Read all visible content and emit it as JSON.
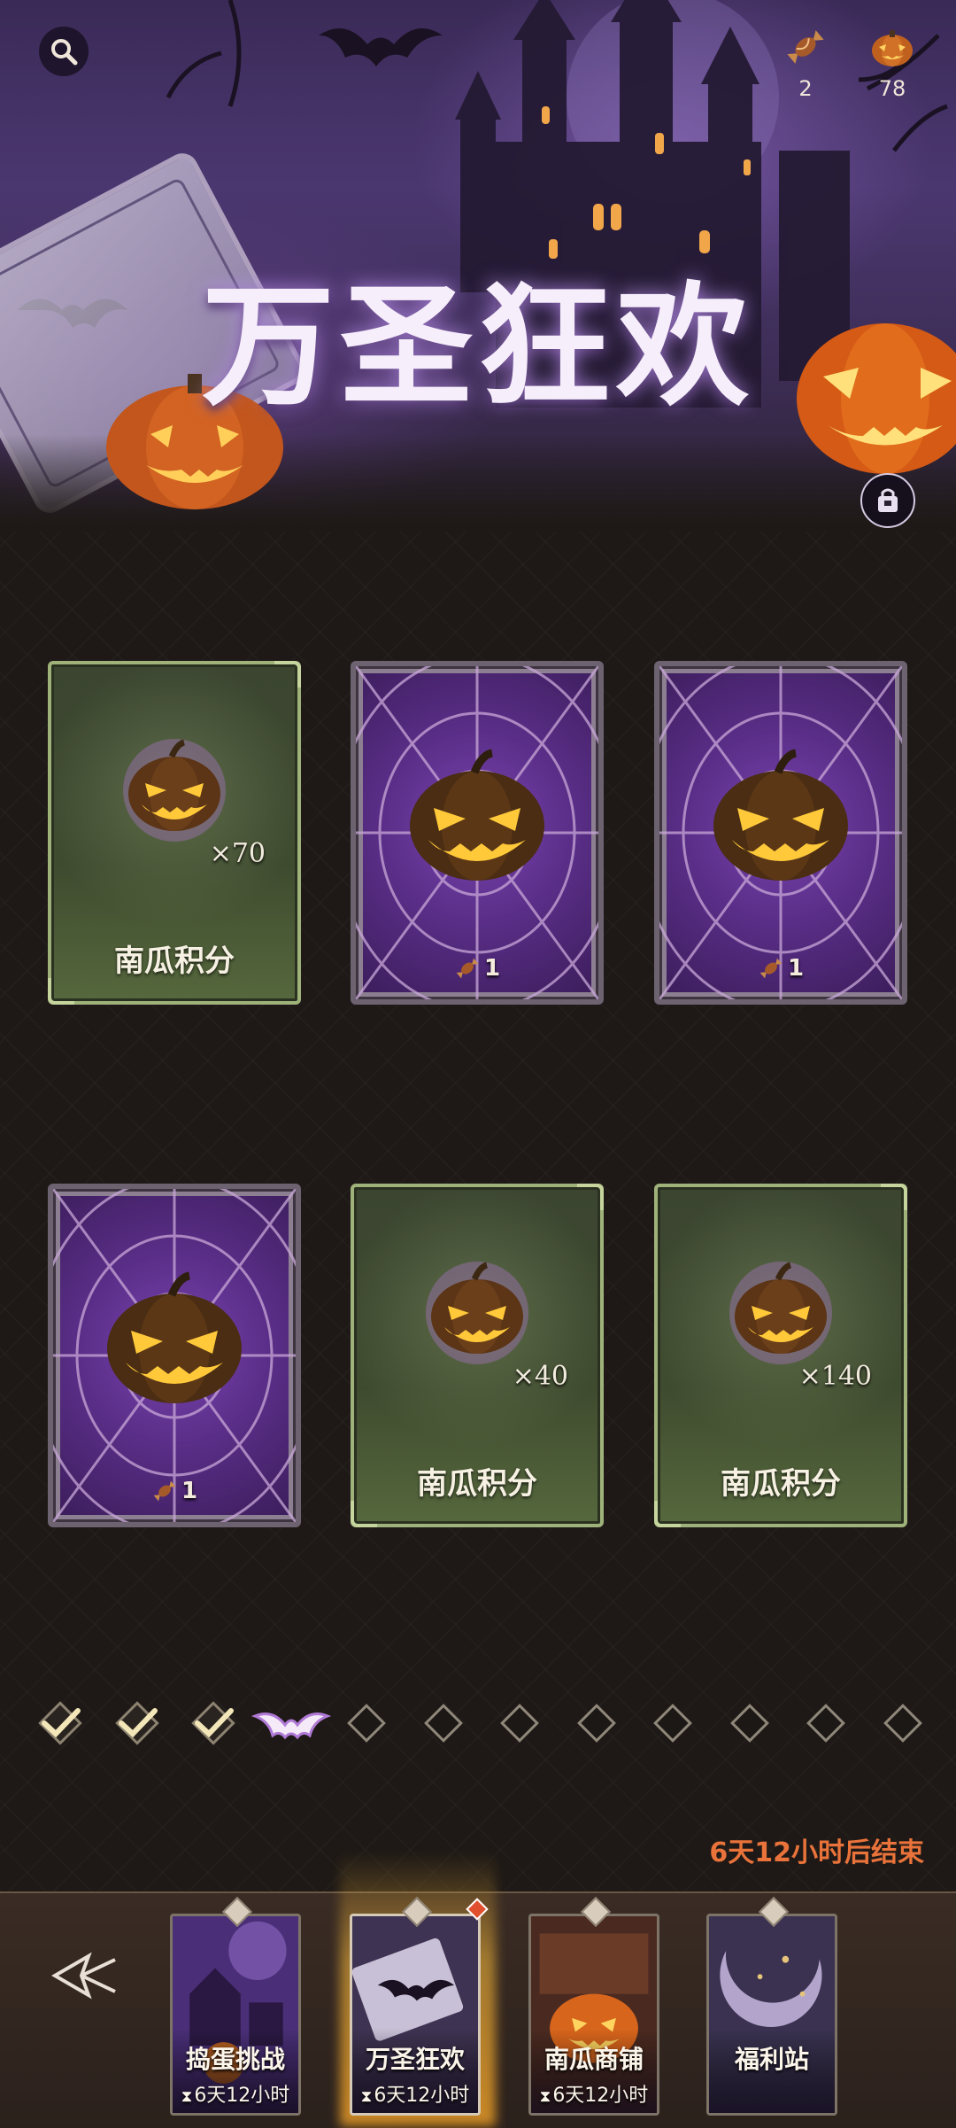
{
  "banner": {
    "title": "万圣狂欢",
    "currencies": [
      {
        "icon": "candy-icon",
        "value": "2"
      },
      {
        "icon": "pumpkin-icon",
        "value": "78"
      }
    ]
  },
  "cards": [
    {
      "type": "reward",
      "label": "南瓜积分",
      "multiplier": "×70"
    },
    {
      "type": "hidden",
      "cost": "1"
    },
    {
      "type": "hidden",
      "cost": "1"
    },
    {
      "type": "hidden",
      "cost": "1"
    },
    {
      "type": "reward",
      "label": "南瓜积分",
      "multiplier": "×40"
    },
    {
      "type": "reward",
      "label": "南瓜积分",
      "multiplier": "×140"
    }
  ],
  "progress": {
    "completed": 3,
    "current": 4,
    "total": 12
  },
  "end_text": "6天12小时后结束",
  "tabs": [
    {
      "name": "捣蛋挑战",
      "time": "6天12小时",
      "active": false
    },
    {
      "name": "万圣狂欢",
      "time": "6天12小时",
      "active": true
    },
    {
      "name": "南瓜商铺",
      "time": "6天12小时",
      "active": false
    },
    {
      "name": "福利站",
      "time": "",
      "active": false
    }
  ],
  "colors": {
    "accent_orange": "#e9733a",
    "reward_green": "#3f4b2f",
    "hidden_purple": "#5a2e88"
  }
}
